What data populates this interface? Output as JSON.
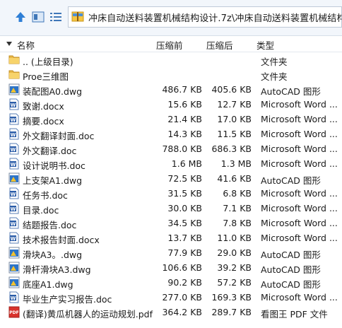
{
  "address_bar": {
    "path": "冲床自动送料装置机械结构设计.7z\\冲床自动送料装置机械结构设计 - "
  },
  "columns": {
    "name": "名称",
    "size": "压缩前",
    "compressed": "压缩后",
    "type": "类型"
  },
  "files": [
    {
      "name": ".. (上级目录)",
      "size": "",
      "compressed": "",
      "type": "文件夹",
      "icon": "folder-icon"
    },
    {
      "name": "Proe三维图",
      "size": "",
      "compressed": "",
      "type": "文件夹",
      "icon": "folder-icon"
    },
    {
      "name": "装配图A0.dwg",
      "size": "486.7 KB",
      "compressed": "405.6 KB",
      "type": "AutoCAD 图形",
      "icon": "autocad-file-icon"
    },
    {
      "name": "致谢.docx",
      "size": "15.6 KB",
      "compressed": "12.7 KB",
      "type": "Microsoft Word ...",
      "icon": "word-file-icon"
    },
    {
      "name": "摘要.docx",
      "size": "21.4 KB",
      "compressed": "17.0 KB",
      "type": "Microsoft Word ...",
      "icon": "word-file-icon"
    },
    {
      "name": "外文翻译封面.doc",
      "size": "14.3 KB",
      "compressed": "11.5 KB",
      "type": "Microsoft Word ...",
      "icon": "word-file-icon"
    },
    {
      "name": "外文翻译.doc",
      "size": "788.0 KB",
      "compressed": "686.3 KB",
      "type": "Microsoft Word ...",
      "icon": "word-file-icon"
    },
    {
      "name": "设计说明书.doc",
      "size": "1.6 MB",
      "compressed": "1.3 MB",
      "type": "Microsoft Word ...",
      "icon": "word-file-icon"
    },
    {
      "name": "上支架A1.dwg",
      "size": "72.5 KB",
      "compressed": "41.6 KB",
      "type": "AutoCAD 图形",
      "icon": "autocad-file-icon"
    },
    {
      "name": "任务书.doc",
      "size": "31.5 KB",
      "compressed": "6.8 KB",
      "type": "Microsoft Word ...",
      "icon": "word-file-icon"
    },
    {
      "name": "目录.doc",
      "size": "30.0 KB",
      "compressed": "7.1 KB",
      "type": "Microsoft Word ...",
      "icon": "word-file-icon"
    },
    {
      "name": "结题报告.doc",
      "size": "34.5 KB",
      "compressed": "7.8 KB",
      "type": "Microsoft Word ...",
      "icon": "word-file-icon"
    },
    {
      "name": "技术报告封面.docx",
      "size": "13.7 KB",
      "compressed": "11.0 KB",
      "type": "Microsoft Word ...",
      "icon": "word-file-icon"
    },
    {
      "name": "滑块A3。.dwg",
      "size": "77.9 KB",
      "compressed": "29.0 KB",
      "type": "AutoCAD 图形",
      "icon": "autocad-file-icon"
    },
    {
      "name": "滑杆滑块A3.dwg",
      "size": "106.6 KB",
      "compressed": "39.2 KB",
      "type": "AutoCAD 图形",
      "icon": "autocad-file-icon"
    },
    {
      "name": "底座A1.dwg",
      "size": "90.2 KB",
      "compressed": "57.2 KB",
      "type": "AutoCAD 图形",
      "icon": "autocad-file-icon"
    },
    {
      "name": "毕业生产实习报告.doc",
      "size": "277.0 KB",
      "compressed": "169.3 KB",
      "type": "Microsoft Word ...",
      "icon": "word-file-icon"
    },
    {
      "name": "(翻译)黄瓜机器人的运动规划.pdf",
      "size": "364.2 KB",
      "compressed": "289.7 KB",
      "type": "看图王 PDF 文件",
      "icon": "pdf-file-icon"
    }
  ]
}
